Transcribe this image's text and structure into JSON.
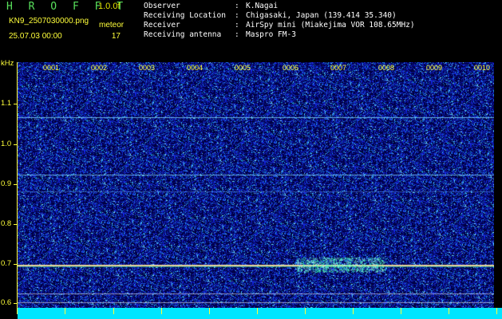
{
  "header": {
    "logo": "H R O F F T",
    "version": "1.0.0f",
    "filename": "KN9_2507030000.png",
    "datetime": "25.07.03 00:00",
    "meteor_label": "meteor",
    "meteor_count": "17"
  },
  "info": [
    {
      "key": "Observer",
      "sep": ":",
      "value": "K.Nagai"
    },
    {
      "key": "Receiving Location",
      "sep": ":",
      "value": "Chigasaki, Japan (139.414 35.340)"
    },
    {
      "key": "Receiver",
      "sep": ":",
      "value": "AirSpy mini (Miakejima VOR 108.65MHz)"
    },
    {
      "key": "Receiving antenna",
      "sep": ":",
      "value": "Maspro FM-3"
    }
  ],
  "axis": {
    "y_unit": "kHz",
    "y_ticks": [
      "1.1",
      "1.0",
      "0.9",
      "0.8",
      "0.7",
      "0.6"
    ],
    "x_ticks": [
      "0001",
      "0002",
      "0003",
      "0004",
      "0005",
      "0006",
      "0007",
      "0008",
      "0009",
      "0010"
    ]
  },
  "colors": {
    "label": "#ffff3a",
    "logo": "#58e05c",
    "background": "#000044",
    "bottom_bar": "#00e5ff"
  }
}
